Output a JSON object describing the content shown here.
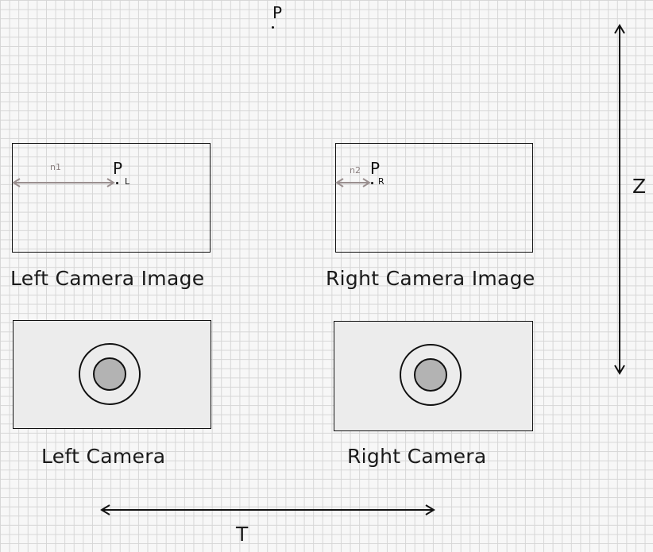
{
  "point": {
    "label": "P"
  },
  "left_image": {
    "caption": "Left Camera Image",
    "point_label": "P",
    "point_sub": "L",
    "offset_label": "n1"
  },
  "right_image": {
    "caption": "Right Camera Image",
    "point_label": "P",
    "point_sub": "R",
    "offset_label": "n2"
  },
  "left_camera": {
    "caption": "Left Camera"
  },
  "right_camera": {
    "caption": "Right Camera"
  },
  "baseline": {
    "label": "T"
  },
  "depth": {
    "label": "Z"
  },
  "colors": {
    "grid": "#d6d6d6",
    "background": "#f7f7f7",
    "stroke": "#111111",
    "offset_arrow": "#9a8f8f",
    "camera_body": "#ececec",
    "lens_core": "#b3b3b3"
  }
}
